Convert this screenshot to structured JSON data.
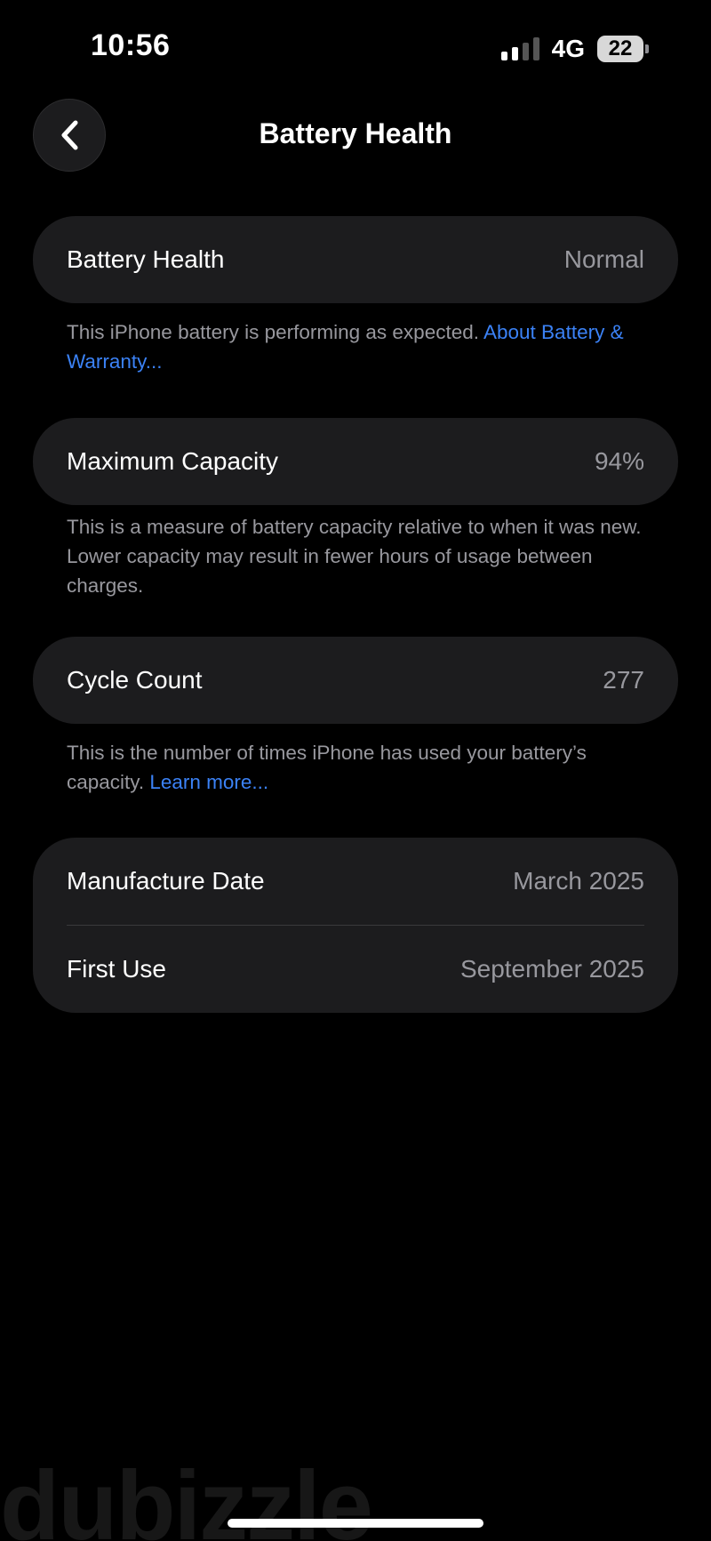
{
  "status_bar": {
    "time": "10:56",
    "network": "4G",
    "battery_level": "22"
  },
  "nav": {
    "title": "Battery Health"
  },
  "battery_health": {
    "label": "Battery Health",
    "value": "Normal",
    "note_text": "This iPhone battery is performing as expected. ",
    "note_link": "About Battery & Warranty..."
  },
  "maximum_capacity": {
    "label": "Maximum Capacity",
    "value": "94%",
    "note_text": "This is a measure of battery capacity relative to when it was new. Lower capacity may result in fewer hours of usage between charges."
  },
  "cycle_count": {
    "label": "Cycle Count",
    "value": "277",
    "note_text": "This is the number of times iPhone has used your battery’s capacity. ",
    "note_link": "Learn more..."
  },
  "dates": {
    "manufacture_label": "Manufacture Date",
    "manufacture_value": "March 2025",
    "first_use_label": "First Use",
    "first_use_value": "September 2025"
  },
  "watermark": "dubizzle",
  "colors": {
    "background": "#000000",
    "card": "#1c1c1e",
    "secondary_text": "#98989e",
    "link": "#3b82f6"
  }
}
